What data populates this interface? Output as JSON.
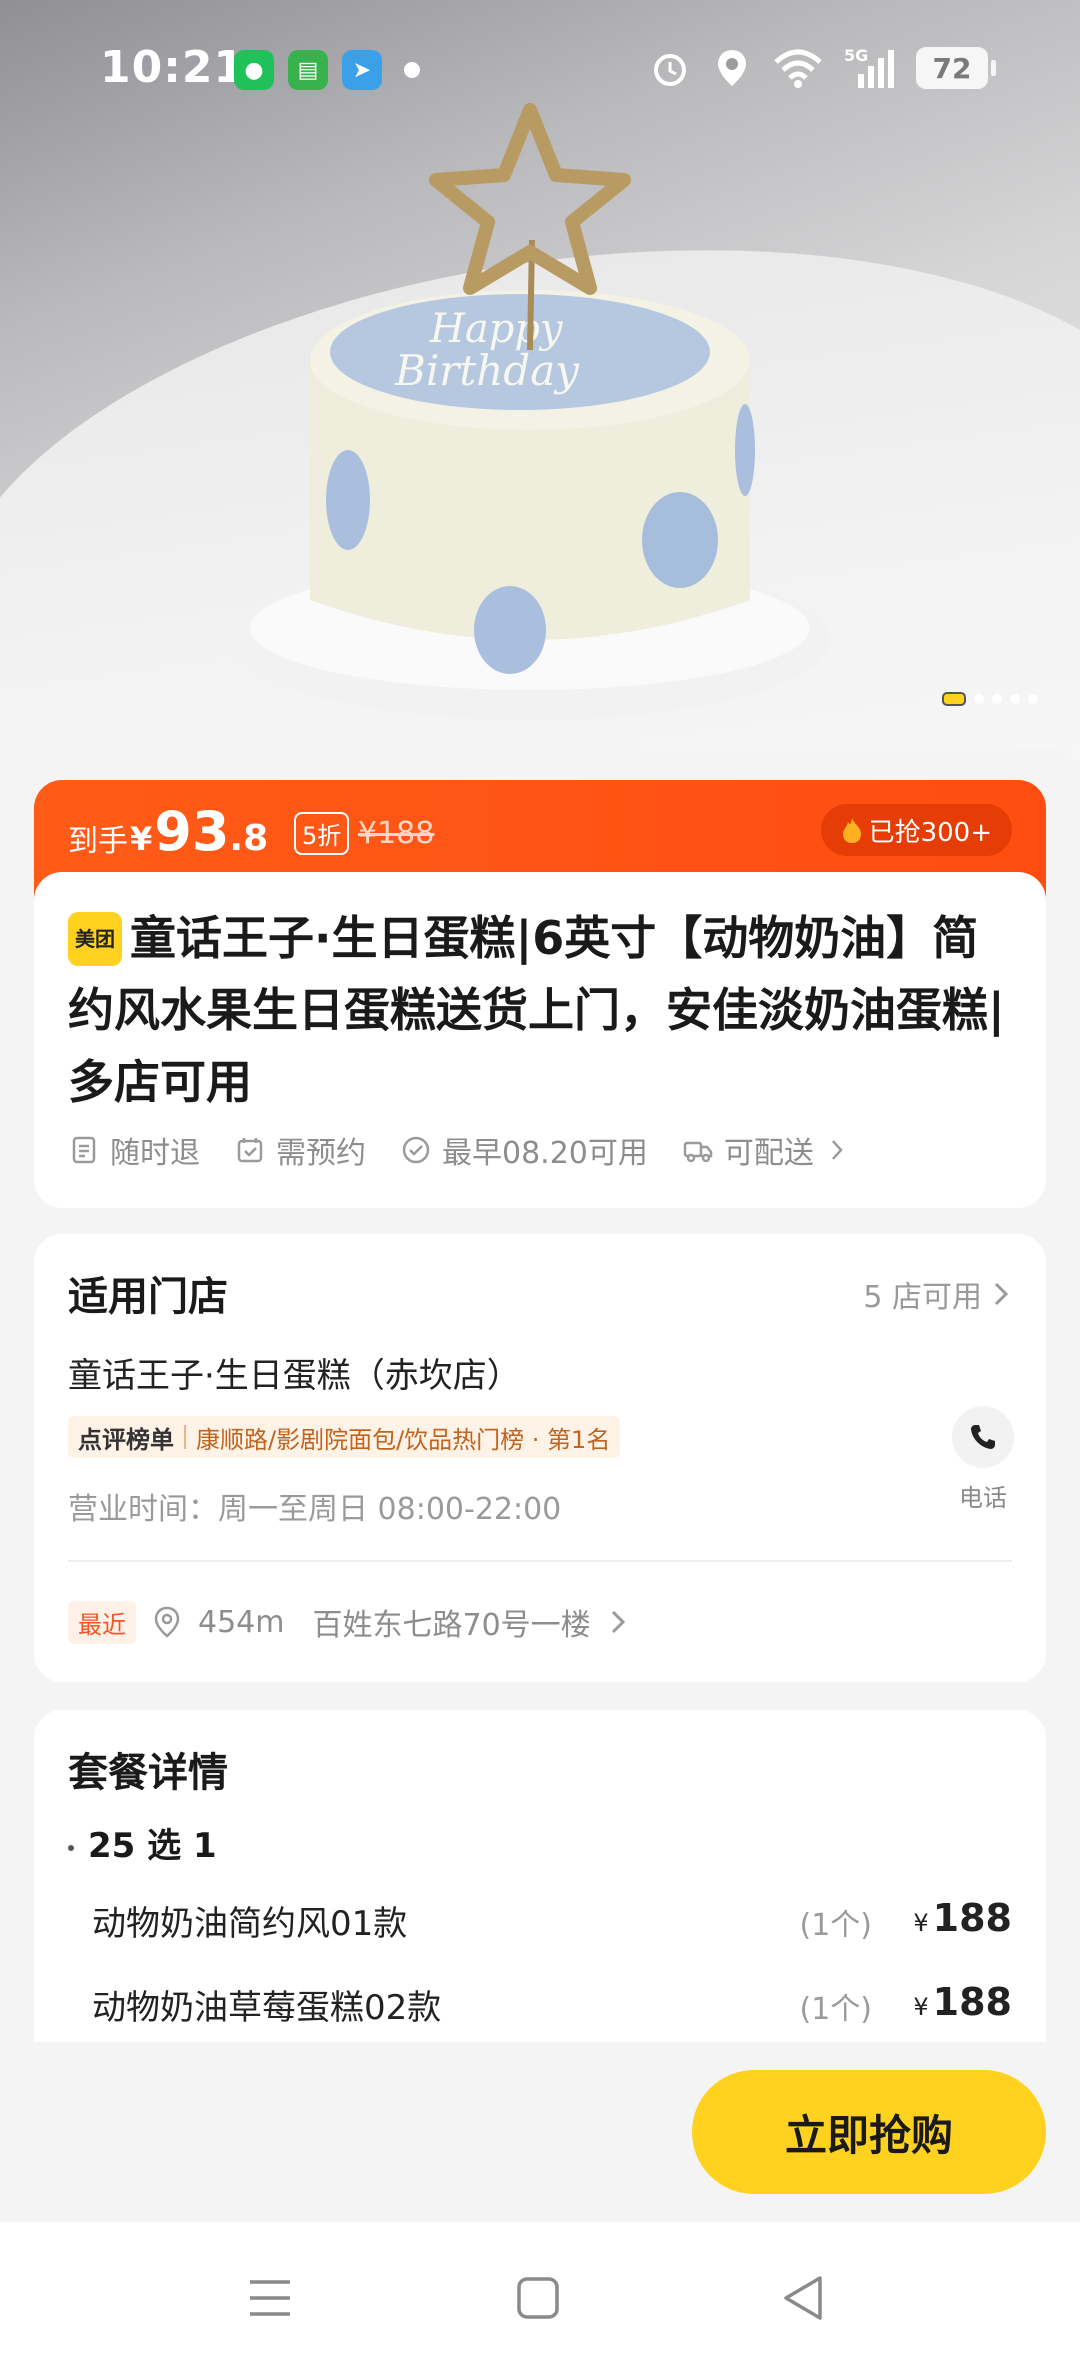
{
  "status_bar": {
    "time": "10:21",
    "network": "5G",
    "battery": "72"
  },
  "price": {
    "label": "到手",
    "currency": "¥",
    "amount_int": "93",
    "amount_dec": ".8",
    "discount": "5折",
    "original": "¥188",
    "grabbed": "已抢300+"
  },
  "product": {
    "brand_badge": "美团",
    "title": "童话王子·生日蛋糕|6英寸【动物奶油】简约风水果生日蛋糕送货上门，安佳淡奶油蛋糕|多店可用",
    "tags": [
      "随时退",
      "需预约",
      "最早08.20可用",
      "可配送"
    ]
  },
  "store": {
    "section_title": "适用门店",
    "count": "5 店可用",
    "name": "童话王子·生日蛋糕（赤坎店）",
    "rank_badge": "点评榜单",
    "rank_text": "康顺路/影剧院面包/饮品热门榜 · 第1名",
    "hours": "营业时间：周一至周日 08:00-22:00",
    "phone_label": "电话",
    "recent_label": "最近",
    "distance": "454m",
    "address": "百姓东七路70号一楼"
  },
  "package": {
    "section_title": "套餐详情",
    "subtitle": "25 选 1",
    "items": [
      {
        "name": "动物奶油简约风01款",
        "qty": "(1个)",
        "currency": "¥",
        "price": "188"
      },
      {
        "name": "动物奶油草莓蛋糕02款",
        "qty": "(1个)",
        "currency": "¥",
        "price": "188"
      }
    ]
  },
  "actions": {
    "buy_label": "立即抢购"
  },
  "colors": {
    "accent_orange": "#ff5b18",
    "accent_yellow": "#ffd21f"
  }
}
